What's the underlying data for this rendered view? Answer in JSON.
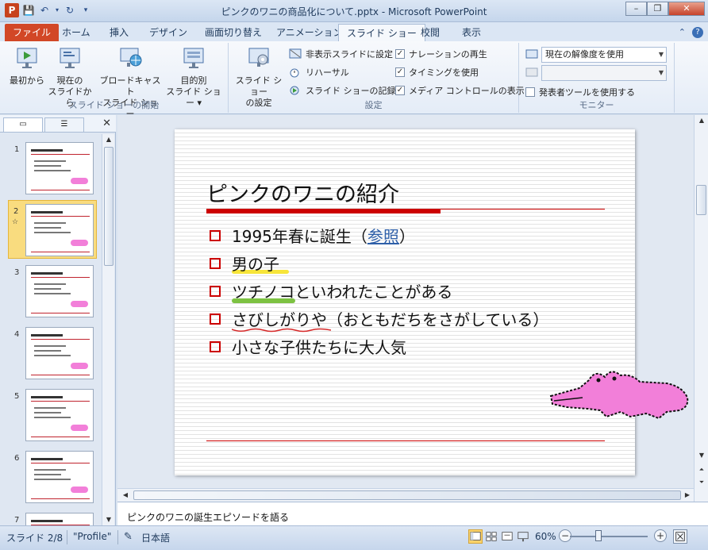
{
  "window": {
    "title": "ピンクのワニの商品化について.pptx - Microsoft PowerPoint",
    "app_letter": "P"
  },
  "tabs": {
    "file": "ファイル",
    "items": [
      "ホーム",
      "挿入",
      "デザイン",
      "画面切り替え",
      "アニメーション",
      "スライド ショー",
      "校閲",
      "表示"
    ],
    "active": "スライド ショー"
  },
  "ribbon": {
    "start_group": {
      "label": "スライド ショーの開始",
      "from_beginning": "最初から",
      "from_current_1": "現在の",
      "from_current_2": "スライドから",
      "broadcast_1": "ブロードキャスト",
      "broadcast_2": "スライド ショー",
      "custom_1": "目的別",
      "custom_2": "スライド ショー ▾"
    },
    "setup_group": {
      "label": "設定",
      "setup_1": "スライド ショー",
      "setup_2": "の設定",
      "hide_slide": "非表示スライドに設定",
      "rehearse": "リハーサル",
      "record": "スライド ショーの記録 ▾",
      "play_narration": "ナレーションの再生",
      "use_timings": "タイミングを使用",
      "show_media_controls": "メディア コントロールの表示",
      "play_narration_checked": true,
      "use_timings_checked": true,
      "show_media_controls_checked": true
    },
    "monitor_group": {
      "label": "モニター",
      "resolution": "現在の解像度を使用",
      "show_on": "",
      "presenter_view": "発表者ツールを使用する",
      "presenter_view_checked": false
    }
  },
  "thumbnails": {
    "items": [
      {
        "num": "1"
      },
      {
        "num": "2",
        "selected": true,
        "star": "☆"
      },
      {
        "num": "3"
      },
      {
        "num": "4"
      },
      {
        "num": "5"
      },
      {
        "num": "6"
      },
      {
        "num": "7"
      }
    ]
  },
  "slide": {
    "title": "ピンクのワニの紹介",
    "bullets": [
      {
        "text_a": "1995年春に誕生（",
        "link": "参照",
        "text_b": "）"
      },
      {
        "text": "男の子"
      },
      {
        "text": "ツチノコといわれたことがある"
      },
      {
        "text": "さびしがりや（おともだちをさがしている）"
      },
      {
        "text": "小さな子供たちに大人気"
      }
    ],
    "colors": {
      "accent": "#cc0000",
      "croc": "#f27fd9",
      "link": "#2e5fa8",
      "yellow": "#f7e53a",
      "green": "#7dc242"
    }
  },
  "notes": {
    "text": "ピンクのワニの誕生エピソードを語る"
  },
  "statusbar": {
    "slide_pos": "スライド 2/8",
    "theme": "\"Profile\"",
    "language": "日本語",
    "zoom": "60%"
  }
}
